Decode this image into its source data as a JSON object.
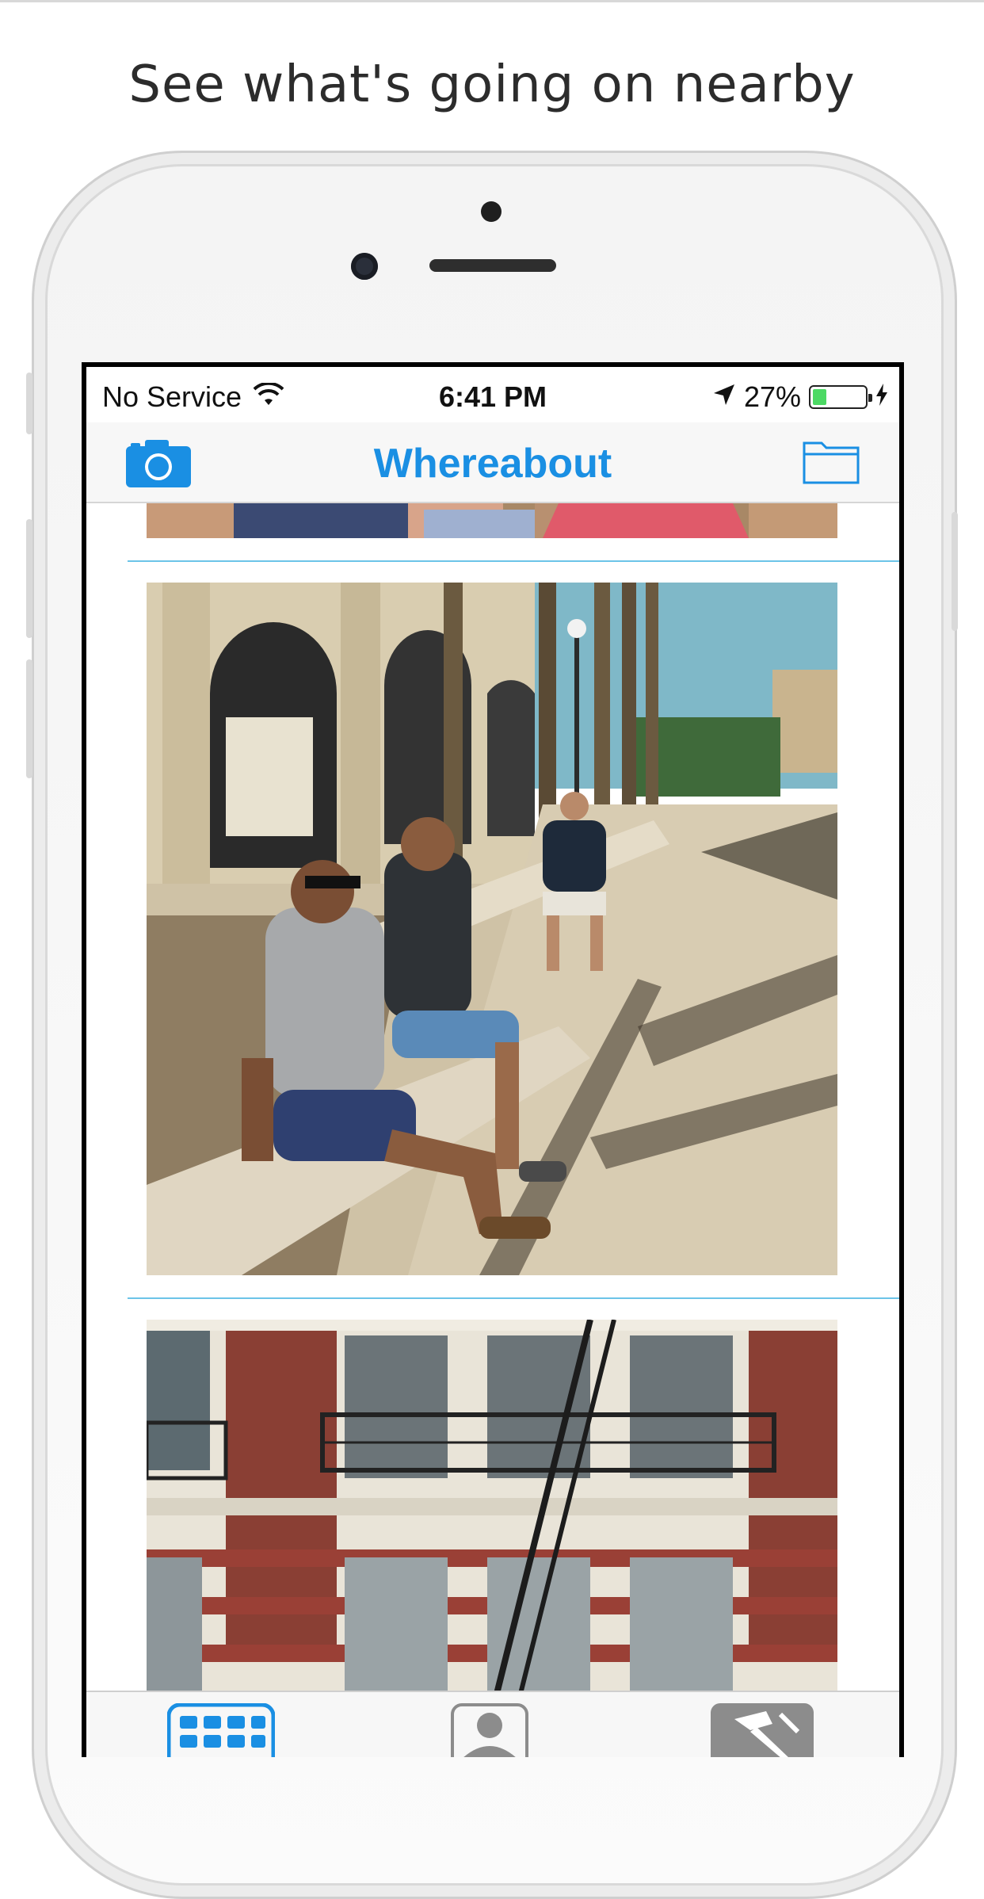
{
  "headline": "See what's going on nearby",
  "status_bar": {
    "carrier": "No Service",
    "time": "6:41 PM",
    "battery_percent": "27%",
    "battery_level": 0.27
  },
  "nav": {
    "title": "Whereabout",
    "left_icon": "camera-icon",
    "right_icon": "folder-icon"
  },
  "feed": {
    "items": [
      {
        "subject": "partial photo of people seated on a wooden deck"
      },
      {
        "subject": "three people sitting on a stone ledge under palm trees and arches"
      },
      {
        "subject": "red brick building facade with balconies and fire escape"
      }
    ]
  },
  "tab_bar": {
    "tabs": [
      {
        "icon": "grid-icon",
        "selected": true
      },
      {
        "icon": "profile-icon",
        "selected": false
      },
      {
        "icon": "hammer-icon",
        "selected": false
      }
    ]
  },
  "colors": {
    "accent": "#1a8fe3",
    "separator": "#6cc4e8"
  }
}
